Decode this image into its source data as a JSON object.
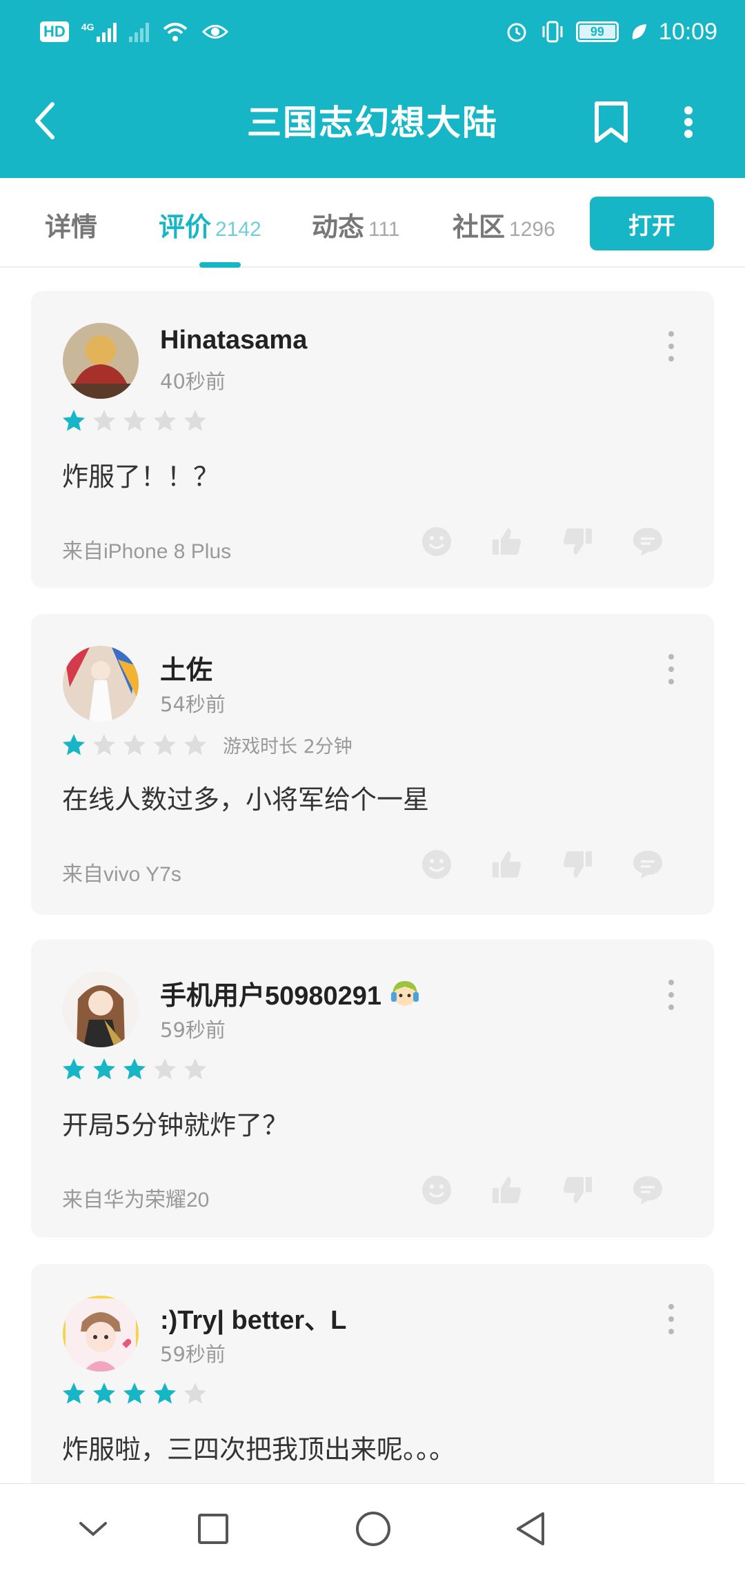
{
  "status_bar": {
    "hd_label": "HD",
    "network_label": "4G",
    "battery_level": "99",
    "time": "10:09"
  },
  "app_bar": {
    "title": "三国志幻想大陆"
  },
  "tabs": [
    {
      "label": "详情",
      "count": ""
    },
    {
      "label": "评价",
      "count": "2142"
    },
    {
      "label": "动态",
      "count": "111"
    },
    {
      "label": "社区",
      "count": "1296"
    }
  ],
  "open_button": "打开",
  "colors": {
    "accent": "#17b6c6",
    "card_bg": "#f6f6f6",
    "star_empty": "#dddddd"
  },
  "reviews": [
    {
      "username": "Hinatasama",
      "time": "40秒前",
      "rating": 1,
      "play_time": "",
      "content": "炸服了！！？",
      "device": "来自iPhone 8 Plus"
    },
    {
      "username": "土佐",
      "time": "54秒前",
      "rating": 1,
      "play_time": "游戏时长 2分钟",
      "content": "在线人数过多，小将军给个一星",
      "device": "来自vivo Y7s"
    },
    {
      "username": "手机用户50980291",
      "time": "59秒前",
      "rating": 3,
      "play_time": "",
      "content": "开局5分钟就炸了？",
      "device": "来自华为荣耀20"
    },
    {
      "username": ":)Try| better、L",
      "time": "59秒前",
      "rating": 4,
      "play_time": "",
      "content": "炸服啦，三四次把我顶出来呢。。。",
      "device": ""
    }
  ]
}
